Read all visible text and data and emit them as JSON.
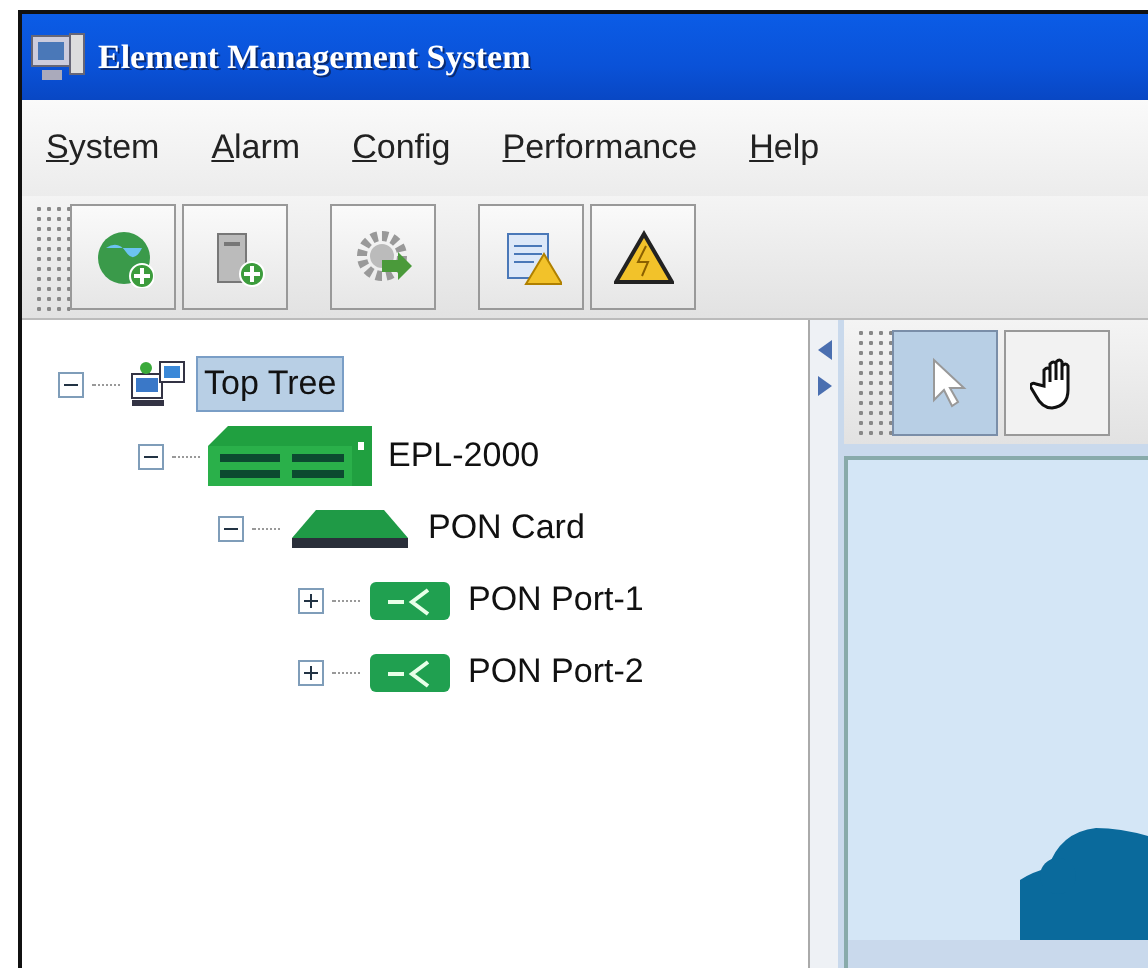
{
  "window": {
    "title": "Element Management System"
  },
  "menu": [
    {
      "label": "System"
    },
    {
      "label": "Alarm"
    },
    {
      "label": "Config"
    },
    {
      "label": "Performance"
    },
    {
      "label": "Help"
    }
  ],
  "toolbar": [
    [
      {
        "kind": "globe"
      },
      {
        "kind": "server"
      }
    ],
    [
      {
        "kind": "gear"
      }
    ],
    [
      {
        "kind": "report"
      },
      {
        "kind": "warning"
      }
    ]
  ],
  "tree": [
    {
      "label": "Top Tree",
      "kind": "network",
      "selected": true,
      "expanded": true,
      "children": [
        {
          "label": "EPL-2000",
          "kind": "chassis",
          "selected": false,
          "expanded": true,
          "children": [
            {
              "label": "PON Card",
              "kind": "card",
              "selected": false,
              "expanded": true,
              "children": [
                {
                  "label": "PON Port-1",
                  "kind": "port",
                  "selected": false,
                  "expanded": false
                },
                {
                  "label": "PON Port-2",
                  "kind": "port",
                  "selected": false,
                  "expanded": false
                }
              ]
            }
          ]
        }
      ]
    }
  ],
  "map_toolbar": [
    {
      "kind": "pointer",
      "selected": true
    },
    {
      "kind": "hand",
      "selected": false
    }
  ],
  "map": {
    "kind": "picture"
  }
}
